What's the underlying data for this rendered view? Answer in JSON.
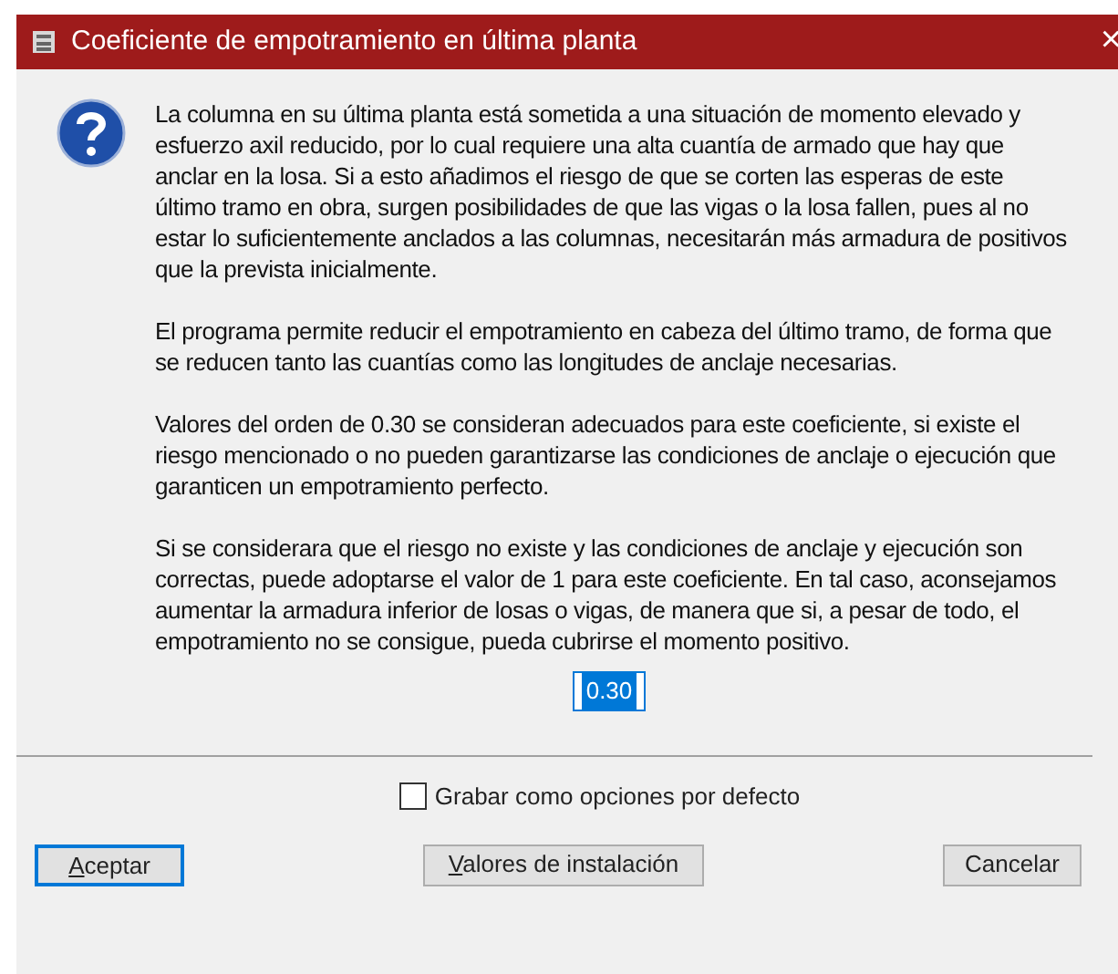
{
  "window": {
    "title": "Coeficiente de empotramiento en última planta",
    "close": "×"
  },
  "paragraphs": [
    "La columna en su última planta está sometida a una situación de momento elevado y esfuerzo axil reducido, por lo cual requiere una alta cuantía de armado que hay que anclar en la losa. Si a esto añadimos el riesgo de que se corten las esperas de este último tramo en obra, surgen posibilidades de que las vigas o la losa fallen, pues al no estar lo suficientemente anclados a las columnas, necesitarán más armadura de positivos que la prevista inicialmente.",
    "El programa permite reducir el empotramiento en cabeza del último tramo, de forma que se reducen tanto las cuantías como las longitudes de anclaje necesarias.",
    "Valores del orden de 0.30 se consideran adecuados para este coeficiente, si existe el riesgo mencionado o no pueden garantizarse las condiciones de anclaje o ejecución que garanticen un empotramiento perfecto.",
    "Si se considerara que el riesgo no existe y las condiciones de anclaje y ejecución son correctas, puede adoptarse el valor de 1 para este coeficiente. En tal caso, aconsejamos aumentar la armadura inferior de losas o vigas, de manera que si, a pesar de todo, el empotramiento no se consigue, pueda cubrirse el momento positivo."
  ],
  "coefficient_field": {
    "value": "0.30",
    "text_selected": true
  },
  "default_checkbox": {
    "label": "Grabar como opciones por defecto",
    "checked": false
  },
  "buttons": [
    {
      "label": "Aceptar",
      "mnemonic": true,
      "focused": true
    },
    {
      "label": "Valores de instalación",
      "mnemonic": true,
      "focused": false
    },
    {
      "label": "Cancelar",
      "mnemonic": false,
      "focused": false
    }
  ]
}
